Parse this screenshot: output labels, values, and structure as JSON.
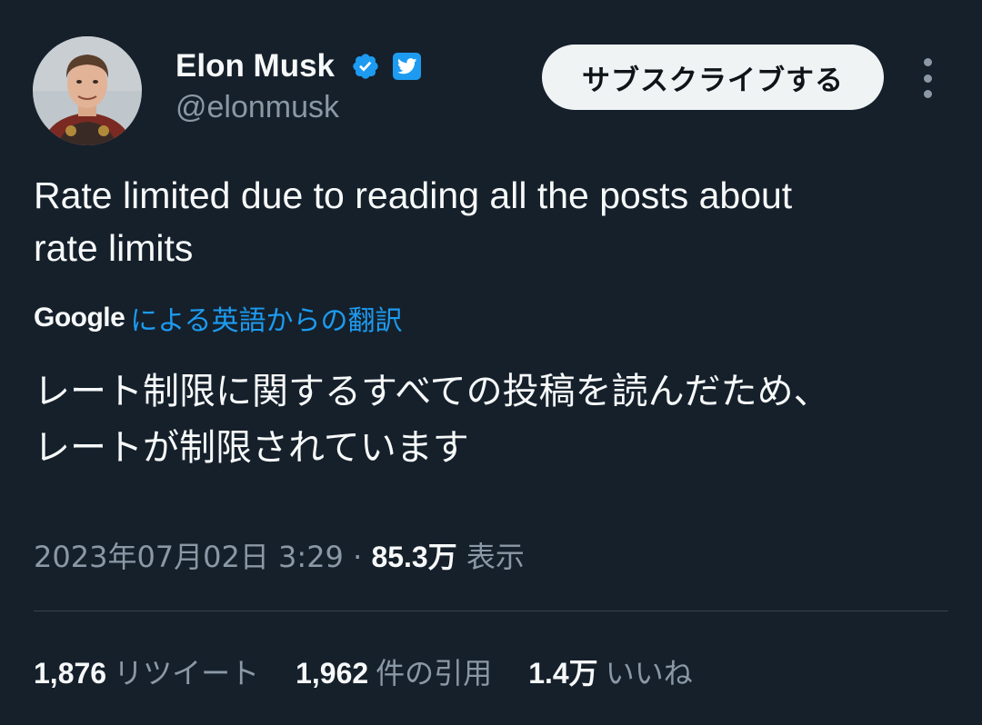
{
  "author": {
    "name": "Elon Musk",
    "handle": "@elonmusk",
    "avatar": "avatar-photo",
    "badges": [
      "verified-check-icon",
      "twitter-bird-icon"
    ]
  },
  "actions": {
    "subscribe_label": "サブスクライブする",
    "more_icon": "more-vertical-icon"
  },
  "tweet": {
    "text_line1": "Rate limited due to reading all the posts about",
    "text_line2": "rate limits"
  },
  "translation": {
    "provider": "Google",
    "link_label": "による英語からの翻訳",
    "text_line1": "レート制限に関するすべての投稿を読んだため、",
    "text_line2": "レートが制限されています"
  },
  "meta": {
    "datetime": "2023年07月02日 3:29",
    "separator": "·",
    "views": "85.3万",
    "views_label": "表示"
  },
  "stats": {
    "retweets": "1,876",
    "retweets_label": "リツイート",
    "quotes": "1,962",
    "quotes_label": "件の引用",
    "likes": "1.4万",
    "likes_label": "いいね"
  },
  "colors": {
    "background": "#15202b",
    "text": "#f7f9f9",
    "secondary_text": "#8b98a5",
    "accent": "#1d9bf0",
    "button_bg": "#eff3f4",
    "divider": "#38444d"
  }
}
